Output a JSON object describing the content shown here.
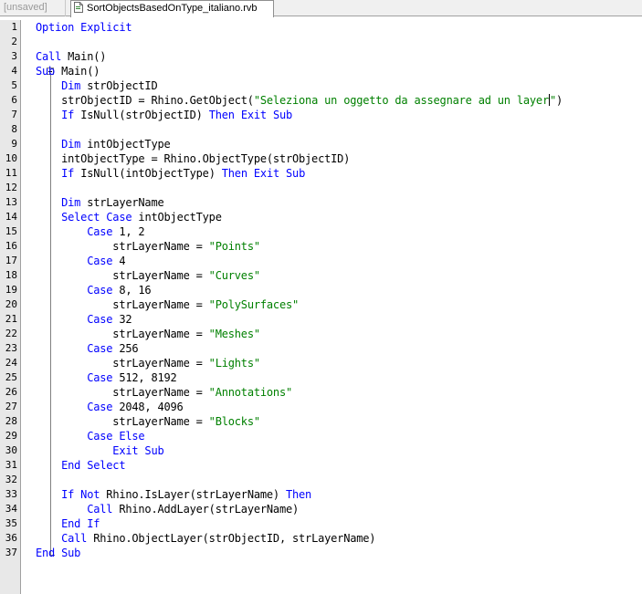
{
  "tabs": [
    {
      "label": "[unsaved]",
      "active": false
    },
    {
      "label": "SortObjectsBasedOnType_italiano.rvb",
      "active": true
    }
  ],
  "colors": {
    "keyword": "#0000ff",
    "string": "#008000",
    "text": "#000000",
    "gutter": "#e8e8e8"
  },
  "lines": [
    {
      "n": "1",
      "tokens": [
        {
          "t": "Option Explicit",
          "c": "kw"
        }
      ]
    },
    {
      "n": "2",
      "tokens": []
    },
    {
      "n": "3",
      "tokens": [
        {
          "t": "Call",
          "c": "kw"
        },
        {
          "t": " Main()",
          "c": "id"
        }
      ]
    },
    {
      "n": "4",
      "tokens": [
        {
          "t": "Sub",
          "c": "kw"
        },
        {
          "t": " Main()",
          "c": "id"
        }
      ]
    },
    {
      "n": "5",
      "tokens": [
        {
          "t": "    ",
          "c": "id"
        },
        {
          "t": "Dim",
          "c": "kw"
        },
        {
          "t": " strObjectID",
          "c": "id"
        }
      ]
    },
    {
      "n": "6",
      "tokens": [
        {
          "t": "    strObjectID = Rhino.GetObject(",
          "c": "id"
        },
        {
          "t": "\"Seleziona un oggetto da assegnare ad un layer",
          "c": "str"
        },
        {
          "t": "|caret|",
          "c": "caret"
        },
        {
          "t": "\"",
          "c": "str"
        },
        {
          "t": ")",
          "c": "id"
        }
      ]
    },
    {
      "n": "7",
      "tokens": [
        {
          "t": "    ",
          "c": "id"
        },
        {
          "t": "If",
          "c": "kw"
        },
        {
          "t": " IsNull(strObjectID) ",
          "c": "id"
        },
        {
          "t": "Then",
          "c": "kw"
        },
        {
          "t": " ",
          "c": "id"
        },
        {
          "t": "Exit Sub",
          "c": "kw"
        }
      ]
    },
    {
      "n": "8",
      "tokens": []
    },
    {
      "n": "9",
      "tokens": [
        {
          "t": "    ",
          "c": "id"
        },
        {
          "t": "Dim",
          "c": "kw"
        },
        {
          "t": " intObjectType",
          "c": "id"
        }
      ]
    },
    {
      "n": "10",
      "tokens": [
        {
          "t": "    intObjectType = Rhino.ObjectType(strObjectID)",
          "c": "id"
        }
      ]
    },
    {
      "n": "11",
      "tokens": [
        {
          "t": "    ",
          "c": "id"
        },
        {
          "t": "If",
          "c": "kw"
        },
        {
          "t": " IsNull(intObjectType) ",
          "c": "id"
        },
        {
          "t": "Then",
          "c": "kw"
        },
        {
          "t": " ",
          "c": "id"
        },
        {
          "t": "Exit Sub",
          "c": "kw"
        }
      ]
    },
    {
      "n": "12",
      "tokens": []
    },
    {
      "n": "13",
      "tokens": [
        {
          "t": "    ",
          "c": "id"
        },
        {
          "t": "Dim",
          "c": "kw"
        },
        {
          "t": " strLayerName",
          "c": "id"
        }
      ]
    },
    {
      "n": "14",
      "tokens": [
        {
          "t": "    ",
          "c": "id"
        },
        {
          "t": "Select Case",
          "c": "kw"
        },
        {
          "t": " intObjectType",
          "c": "id"
        }
      ]
    },
    {
      "n": "15",
      "tokens": [
        {
          "t": "        ",
          "c": "id"
        },
        {
          "t": "Case",
          "c": "kw"
        },
        {
          "t": " 1, 2",
          "c": "id"
        }
      ]
    },
    {
      "n": "16",
      "tokens": [
        {
          "t": "            strLayerName = ",
          "c": "id"
        },
        {
          "t": "\"Points\"",
          "c": "str"
        }
      ]
    },
    {
      "n": "17",
      "tokens": [
        {
          "t": "        ",
          "c": "id"
        },
        {
          "t": "Case",
          "c": "kw"
        },
        {
          "t": " 4",
          "c": "id"
        }
      ]
    },
    {
      "n": "18",
      "tokens": [
        {
          "t": "            strLayerName = ",
          "c": "id"
        },
        {
          "t": "\"Curves\"",
          "c": "str"
        }
      ]
    },
    {
      "n": "19",
      "tokens": [
        {
          "t": "        ",
          "c": "id"
        },
        {
          "t": "Case",
          "c": "kw"
        },
        {
          "t": " 8, 16",
          "c": "id"
        }
      ]
    },
    {
      "n": "20",
      "tokens": [
        {
          "t": "            strLayerName = ",
          "c": "id"
        },
        {
          "t": "\"PolySurfaces\"",
          "c": "str"
        }
      ]
    },
    {
      "n": "21",
      "tokens": [
        {
          "t": "        ",
          "c": "id"
        },
        {
          "t": "Case",
          "c": "kw"
        },
        {
          "t": " 32",
          "c": "id"
        }
      ]
    },
    {
      "n": "22",
      "tokens": [
        {
          "t": "            strLayerName = ",
          "c": "id"
        },
        {
          "t": "\"Meshes\"",
          "c": "str"
        }
      ]
    },
    {
      "n": "23",
      "tokens": [
        {
          "t": "        ",
          "c": "id"
        },
        {
          "t": "Case",
          "c": "kw"
        },
        {
          "t": " 256",
          "c": "id"
        }
      ]
    },
    {
      "n": "24",
      "tokens": [
        {
          "t": "            strLayerName = ",
          "c": "id"
        },
        {
          "t": "\"Lights\"",
          "c": "str"
        }
      ]
    },
    {
      "n": "25",
      "tokens": [
        {
          "t": "        ",
          "c": "id"
        },
        {
          "t": "Case",
          "c": "kw"
        },
        {
          "t": " 512, 8192",
          "c": "id"
        }
      ]
    },
    {
      "n": "26",
      "tokens": [
        {
          "t": "            strLayerName = ",
          "c": "id"
        },
        {
          "t": "\"Annotations\"",
          "c": "str"
        }
      ]
    },
    {
      "n": "27",
      "tokens": [
        {
          "t": "        ",
          "c": "id"
        },
        {
          "t": "Case",
          "c": "kw"
        },
        {
          "t": " 2048, 4096",
          "c": "id"
        }
      ]
    },
    {
      "n": "28",
      "tokens": [
        {
          "t": "            strLayerName = ",
          "c": "id"
        },
        {
          "t": "\"Blocks\"",
          "c": "str"
        }
      ]
    },
    {
      "n": "29",
      "tokens": [
        {
          "t": "        ",
          "c": "id"
        },
        {
          "t": "Case Else",
          "c": "kw"
        }
      ]
    },
    {
      "n": "30",
      "tokens": [
        {
          "t": "            ",
          "c": "id"
        },
        {
          "t": "Exit Sub",
          "c": "kw"
        }
      ]
    },
    {
      "n": "31",
      "tokens": [
        {
          "t": "    ",
          "c": "id"
        },
        {
          "t": "End Select",
          "c": "kw"
        }
      ]
    },
    {
      "n": "32",
      "tokens": []
    },
    {
      "n": "33",
      "tokens": [
        {
          "t": "    ",
          "c": "id"
        },
        {
          "t": "If Not",
          "c": "kw"
        },
        {
          "t": " Rhino.IsLayer(strLayerName) ",
          "c": "id"
        },
        {
          "t": "Then",
          "c": "kw"
        }
      ]
    },
    {
      "n": "34",
      "tokens": [
        {
          "t": "        ",
          "c": "id"
        },
        {
          "t": "Call",
          "c": "kw"
        },
        {
          "t": " Rhino.AddLayer(strLayerName)",
          "c": "id"
        }
      ]
    },
    {
      "n": "35",
      "tokens": [
        {
          "t": "    ",
          "c": "id"
        },
        {
          "t": "End If",
          "c": "kw"
        }
      ]
    },
    {
      "n": "36",
      "tokens": [
        {
          "t": "    ",
          "c": "id"
        },
        {
          "t": "Call",
          "c": "kw"
        },
        {
          "t": " Rhino.ObjectLayer(strObjectID, strLayerName)",
          "c": "id"
        }
      ]
    },
    {
      "n": "37",
      "tokens": [
        {
          "t": "End Sub",
          "c": "kw"
        }
      ]
    }
  ]
}
